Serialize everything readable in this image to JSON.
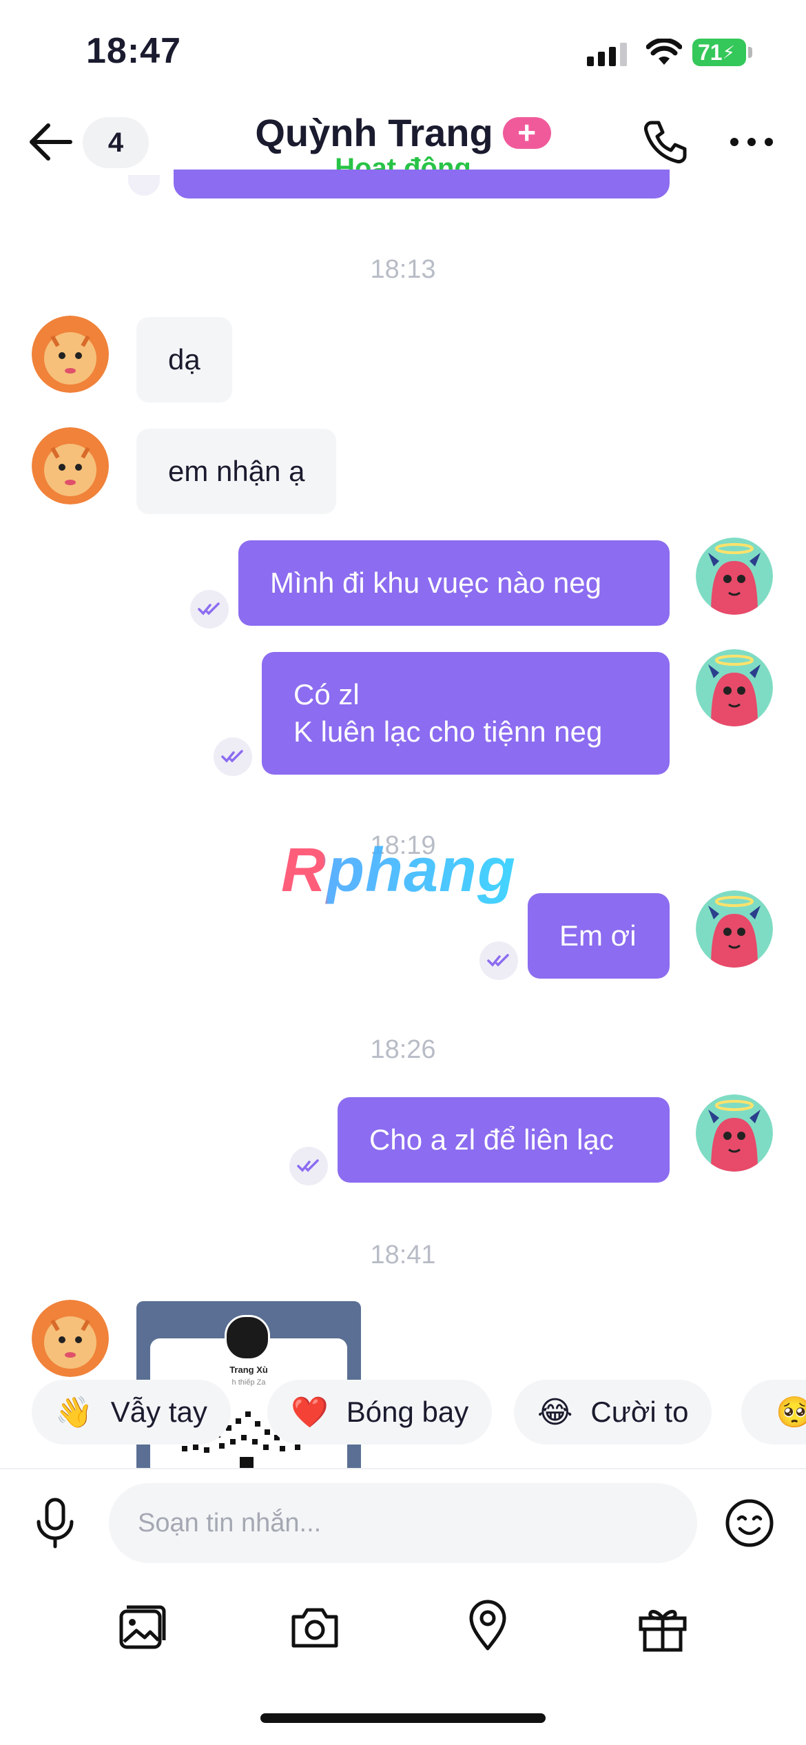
{
  "status_bar": {
    "time": "18:47",
    "battery": "71"
  },
  "header": {
    "unread_count": "4",
    "contact_name": "Quỳnh Trang",
    "plus_badge": "+",
    "presence": "Hoạt động"
  },
  "messages": {
    "t1": "18:13",
    "in1": "dạ",
    "in2": "em nhận ạ",
    "out1": "Mình đi khu vuẹc nào neg",
    "out2_line1": "Có zl",
    "out2_line2": "K luên lạc cho tiệnn neg",
    "t2": "18:19",
    "out3": "Em ơi",
    "t3": "18:26",
    "out4": "Cho a zl để liên lạc",
    "t4": "18:41",
    "card_name": "Trang Xù",
    "card_sub": "h thiếp Za"
  },
  "watermark": "Rphang",
  "quick_replies": [
    {
      "emoji": "👋",
      "label": "Vẫy tay"
    },
    {
      "emoji": "❤️",
      "label": "Bóng bay"
    },
    {
      "emoji": "😂",
      "label": "Cười to"
    },
    {
      "emoji": "🥺",
      "label": ""
    }
  ],
  "composer": {
    "placeholder": "Soạn tin nhắn..."
  },
  "icons": [
    "back-arrow-icon",
    "phone-icon",
    "more-icon",
    "mic-icon",
    "emoji-icon",
    "image-icon",
    "camera-icon",
    "location-icon",
    "gift-icon",
    "read-check-icon"
  ],
  "colors": {
    "accent": "#8c6cf0",
    "online": "#28c346",
    "badge": "#f05a9a"
  }
}
